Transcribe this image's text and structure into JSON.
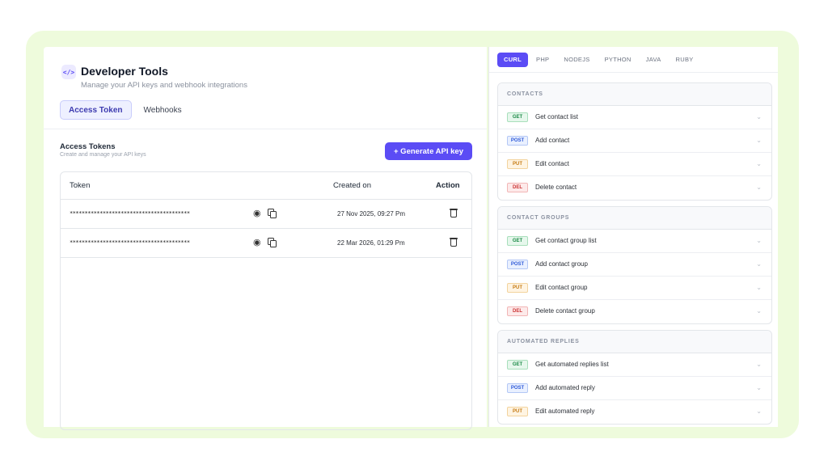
{
  "header": {
    "icon": "code-icon",
    "icon_glyph": "</>",
    "title": "Developer Tools",
    "subtitle": "Manage your API keys and webhook integrations"
  },
  "tabs": [
    {
      "label": "Access Token",
      "active": true
    },
    {
      "label": "Webhooks",
      "active": false
    }
  ],
  "section": {
    "title": "Access Tokens",
    "subtitle": "Create and manage your API keys",
    "generate_button": "+ Generate API key"
  },
  "table": {
    "headers": {
      "token": "Token",
      "created": "Created on",
      "action": "Action"
    },
    "rows": [
      {
        "token": "****************************************",
        "created": "27 Nov 2025, 09:27 Pm"
      },
      {
        "token": "****************************************",
        "created": "22 Mar 2026, 01:29 Pm"
      }
    ]
  },
  "languages": [
    {
      "label": "CURL",
      "active": true
    },
    {
      "label": "PHP",
      "active": false
    },
    {
      "label": "NODEJS",
      "active": false
    },
    {
      "label": "PYTHON",
      "active": false
    },
    {
      "label": "JAVA",
      "active": false
    },
    {
      "label": "RUBY",
      "active": false
    }
  ],
  "groups": [
    {
      "title": "CONTACTS",
      "endpoints": [
        {
          "method": "GET",
          "label": "Get contact list"
        },
        {
          "method": "POST",
          "label": "Add contact"
        },
        {
          "method": "PUT",
          "label": "Edit contact"
        },
        {
          "method": "DEL",
          "label": "Delete contact"
        }
      ]
    },
    {
      "title": "CONTACT GROUPS",
      "endpoints": [
        {
          "method": "GET",
          "label": "Get contact group list"
        },
        {
          "method": "POST",
          "label": "Add contact group"
        },
        {
          "method": "PUT",
          "label": "Edit contact group"
        },
        {
          "method": "DEL",
          "label": "Delete contact group"
        }
      ]
    },
    {
      "title": "AUTOMATED REPLIES",
      "endpoints": [
        {
          "method": "GET",
          "label": "Get automated replies list"
        },
        {
          "method": "POST",
          "label": "Add automated reply"
        },
        {
          "method": "PUT",
          "label": "Edit automated reply"
        }
      ]
    }
  ],
  "colors": {
    "accent": "#5b4cf5",
    "frame": "#eefbdc",
    "get": "#1b8a46",
    "post": "#2f5ad8",
    "put": "#c57a12",
    "del": "#cc3333"
  }
}
